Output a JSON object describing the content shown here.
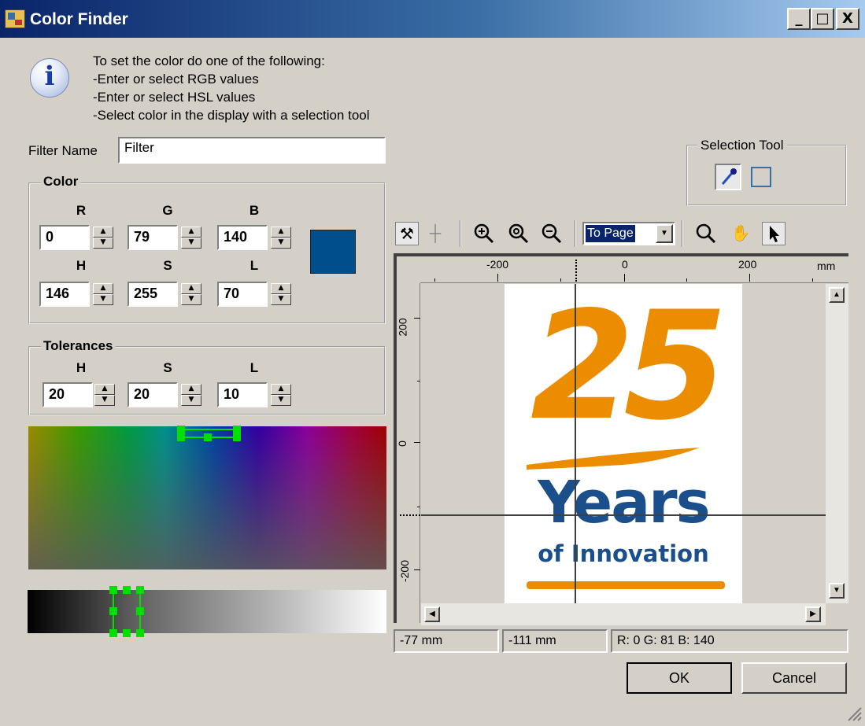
{
  "window": {
    "title": "Color Finder",
    "minimize": "_",
    "maximize": "□",
    "close": "X"
  },
  "instructions": [
    "To set the color do one of the following:",
    "-Enter or select RGB values",
    "-Enter or select HSL values",
    "-Select color in the display with a selection tool"
  ],
  "filter": {
    "label": "Filter Name",
    "value": "Filter"
  },
  "color_group": {
    "title": "Color",
    "rgb": [
      {
        "label": "R",
        "value": "0"
      },
      {
        "label": "G",
        "value": "79"
      },
      {
        "label": "B",
        "value": "140"
      }
    ],
    "hsl": [
      {
        "label": "H",
        "value": "146"
      },
      {
        "label": "S",
        "value": "255"
      },
      {
        "label": "L",
        "value": "70"
      }
    ],
    "swatch_color": "#004f8c"
  },
  "tolerances": {
    "title": "Tolerances",
    "items": [
      {
        "label": "H",
        "value": "20"
      },
      {
        "label": "S",
        "value": "20"
      },
      {
        "label": "L",
        "value": "10"
      }
    ]
  },
  "selection_tool": {
    "title": "Selection Tool"
  },
  "toolbar": {
    "zoom_select_value": "To Page"
  },
  "ruler": {
    "h_labels": [
      "-200",
      "0",
      "200",
      "mm"
    ],
    "v_labels": [
      "200",
      "0",
      "-200"
    ]
  },
  "preview": {
    "big_number": "25",
    "word": "Years",
    "tagline": "of Innovation",
    "orange": "#ec8c00",
    "blue": "#1a4f8c"
  },
  "status": {
    "x": "-77 mm",
    "y": "-111 mm",
    "rgb": "R: 0 G: 81 B: 140"
  },
  "buttons": {
    "ok": "OK",
    "cancel": "Cancel"
  }
}
